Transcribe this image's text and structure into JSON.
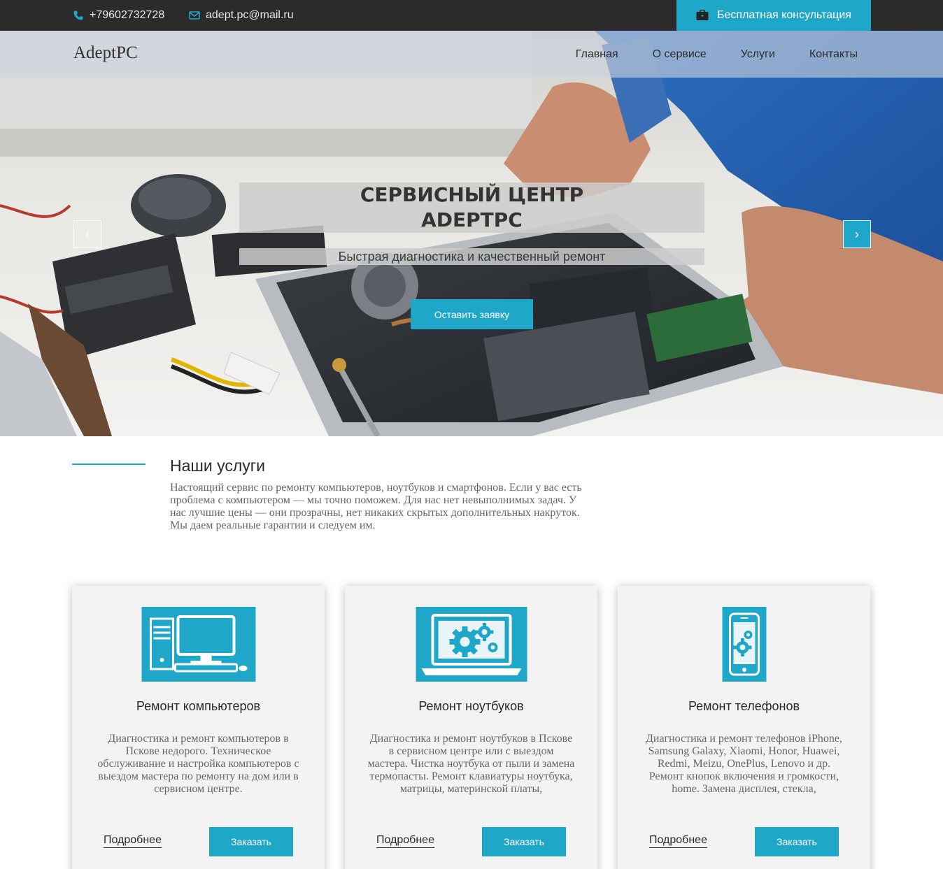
{
  "topbar": {
    "phone": "+79602732728",
    "email": "adept.pc@mail.ru",
    "consult_label": "Бесплатная консультация"
  },
  "header": {
    "logo": "AdeptPC",
    "nav": [
      "Главная",
      "О сервисе",
      "Услуги",
      "Контакты"
    ]
  },
  "hero": {
    "title_line1": "СЕРВИСНЫЙ ЦЕНТР",
    "title_line2": "ADEPTPC",
    "subtitle": "Быстрая диагностика и качественный ремонт",
    "cta_label": "Оставить заявку",
    "prev_symbol": "‹",
    "next_symbol": "›"
  },
  "intro": {
    "title": "Наши услуги",
    "text": "Настоящий сервис по ремонту компьютеров, ноутбуков и смартфонов. Если у вас есть проблема с компьютером — мы точно поможем. Для нас нет невыполнимых задач. У нас лучшие цены — они прозрачны, нет никаких скрытых дополнительных накруток. Мы даем реальные гарантии и следуем им."
  },
  "cards": [
    {
      "icon": "desktop-computer-icon",
      "title": "Ремонт компьютеров",
      "text": "Диагностика и ремонт компьютеров в Пскове недорого. Техническое обслуживание и настройка компьютеров с выездом мастера по ремонту на дом или в сервисном центре.",
      "more_label": "Подробнее",
      "order_label": "Заказать"
    },
    {
      "icon": "laptop-gears-icon",
      "title": "Ремонт ноутбуков",
      "text": "Диагностика и ремонт ноутбуков в Пскове в сервисном центре или с выездом мастера. Чистка ноутбука от пыли и замена термопасты. Ремонт клавиатуры ноутбука, матрицы, материнской платы,",
      "more_label": "Подробнее",
      "order_label": "Заказать"
    },
    {
      "icon": "smartphone-gears-icon",
      "title": "Ремонт телефонов",
      "text": "Диагностика и ремонт телефонов iPhone, Samsung Galaxy, Xiaomi, Honor, Huawei, Redmi, Meizu, OnePlus, Lenovo и др. Ремонт кнопок включения и громкости, home. Замена дисплея, стекла,",
      "more_label": "Подробнее",
      "order_label": "Заказать"
    }
  ],
  "colors": {
    "accent": "#1fa7c9",
    "topbar": "#2b2b2b",
    "card_bg": "#f3f3f3"
  }
}
